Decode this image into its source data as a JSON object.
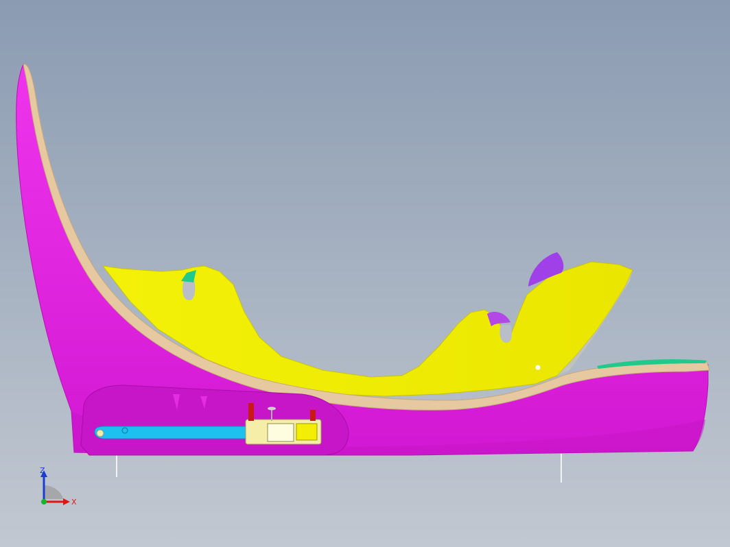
{
  "viewport": {
    "background_top": "#8b9bb2",
    "background_bottom": "#c2c8d1"
  },
  "model": {
    "colors": {
      "shell": "#e21ee0",
      "shell_shade": "#c415c4",
      "seat": "#f2ee05",
      "rim": "#e6c9a0",
      "rail": "#1ec0f0",
      "latch": "#f4eea8",
      "handle": "#a040e8",
      "accent_green": "#21c98a",
      "pin_red": "#c81818"
    }
  },
  "triad": {
    "z_label": "Z",
    "x_label": "X",
    "z_color": "#1b3ad6",
    "x_color": "#e01616",
    "y_color": "#13b52c"
  }
}
